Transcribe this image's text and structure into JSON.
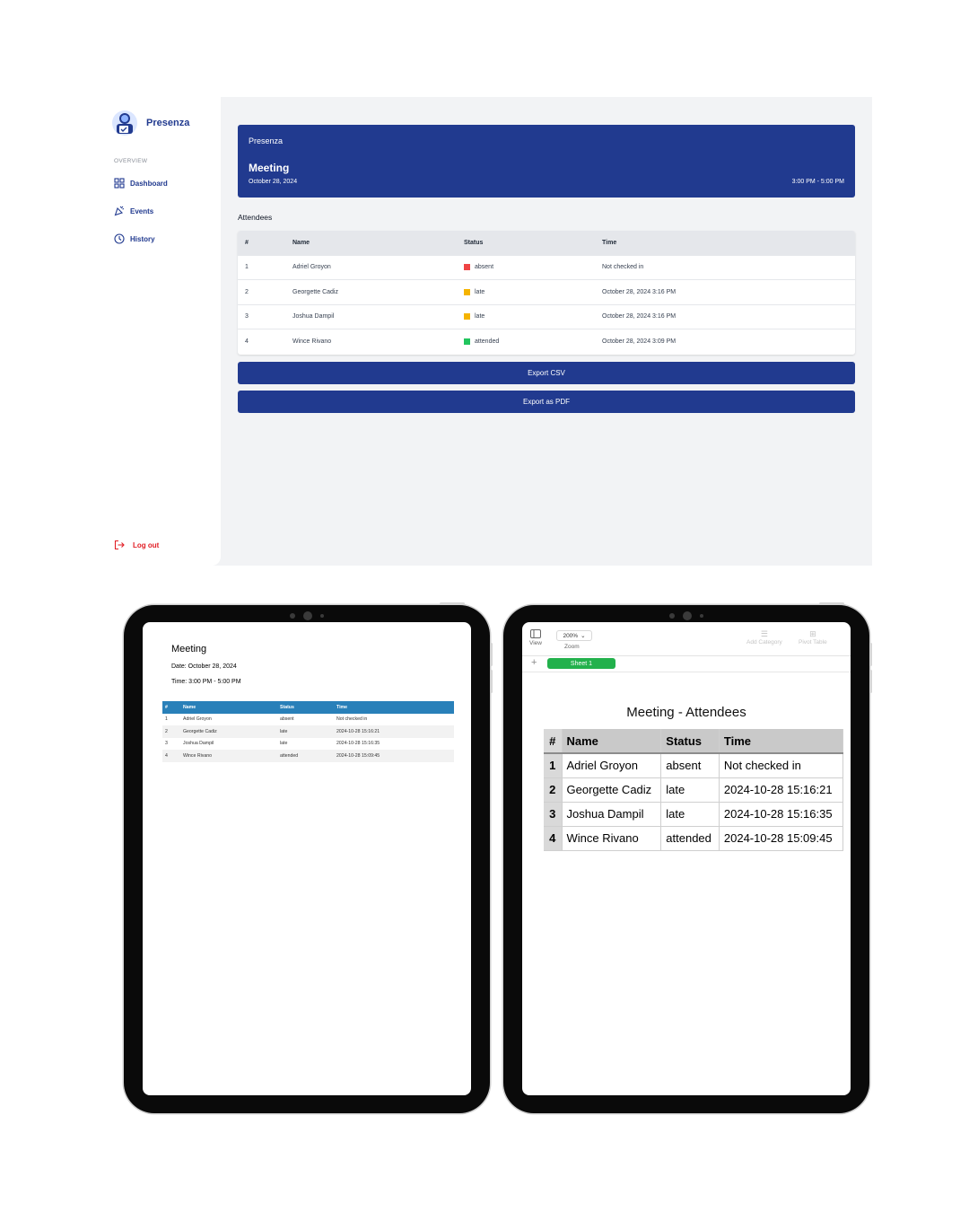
{
  "app": {
    "brand": "Presenza",
    "overview_label": "OVERVIEW",
    "nav": [
      {
        "label": "Dashboard",
        "icon": "grid-icon"
      },
      {
        "label": "Events",
        "icon": "party-icon"
      },
      {
        "label": "History",
        "icon": "clock-icon"
      }
    ],
    "logout_label": "Log out",
    "banner": {
      "app_name": "Presenza",
      "title": "Meeting",
      "date": "October 28, 2024",
      "time": "3:00 PM - 5:00 PM"
    },
    "attendees_label": "Attendees",
    "table": {
      "headers": [
        "#",
        "Name",
        "Status",
        "Time"
      ],
      "rows": [
        {
          "num": "1",
          "name": "Adriel Groyon",
          "status": "absent",
          "status_color": "#ef4444",
          "time": "Not checked in"
        },
        {
          "num": "2",
          "name": "Georgette Cadiz",
          "status": "late",
          "status_color": "#f5b400",
          "time": "October 28, 2024 3:16 PM"
        },
        {
          "num": "3",
          "name": "Joshua Dampil",
          "status": "late",
          "status_color": "#f5b400",
          "time": "October 28, 2024 3:16 PM"
        },
        {
          "num": "4",
          "name": "Wince Rivano",
          "status": "attended",
          "status_color": "#22c55e",
          "time": "October 28, 2024 3:09 PM"
        }
      ]
    },
    "export_csv_label": "Export CSV",
    "export_pdf_label": "Export as PDF",
    "colors": {
      "primary": "#213a8f",
      "danger": "#e11d24"
    }
  },
  "pdf": {
    "title": "Meeting",
    "date": "Date: October 28, 2024",
    "time": "Time: 3:00 PM - 5:00 PM",
    "headers": [
      "#",
      "Name",
      "Status",
      "Time"
    ],
    "rows": [
      {
        "num": "1",
        "name": "Adriel Groyon",
        "status": "absent",
        "time": "Not checked in"
      },
      {
        "num": "2",
        "name": "Georgette Cadiz",
        "status": "late",
        "time": "2024-10-28 15:16:21"
      },
      {
        "num": "3",
        "name": "Joshua Dampil",
        "status": "late",
        "time": "2024-10-28 15:16:35"
      },
      {
        "num": "4",
        "name": "Wince Rivano",
        "status": "attended",
        "time": "2024-10-28 15:09:45"
      }
    ],
    "header_color": "#2980b9"
  },
  "sheet": {
    "toolbar": {
      "view_label": "View",
      "zoom_value": "200%",
      "zoom_label": "Zoom",
      "add_category_label": "Add Category",
      "pivot_table_label": "Pivot Table"
    },
    "tab_label": "Sheet 1",
    "title": "Meeting - Attendees",
    "headers": [
      "#",
      "Name",
      "Status",
      "Time"
    ],
    "rows": [
      {
        "num": "1",
        "name": "Adriel Groyon",
        "status": "absent",
        "time": "Not checked in"
      },
      {
        "num": "2",
        "name": "Georgette Cadiz",
        "status": "late",
        "time": "2024-10-28 15:16:21"
      },
      {
        "num": "3",
        "name": "Joshua Dampil",
        "status": "late",
        "time": "2024-10-28 15:16:35"
      },
      {
        "num": "4",
        "name": "Wince Rivano",
        "status": "attended",
        "time": "2024-10-28 15:09:45"
      }
    ],
    "tab_color": "#22b14c"
  }
}
